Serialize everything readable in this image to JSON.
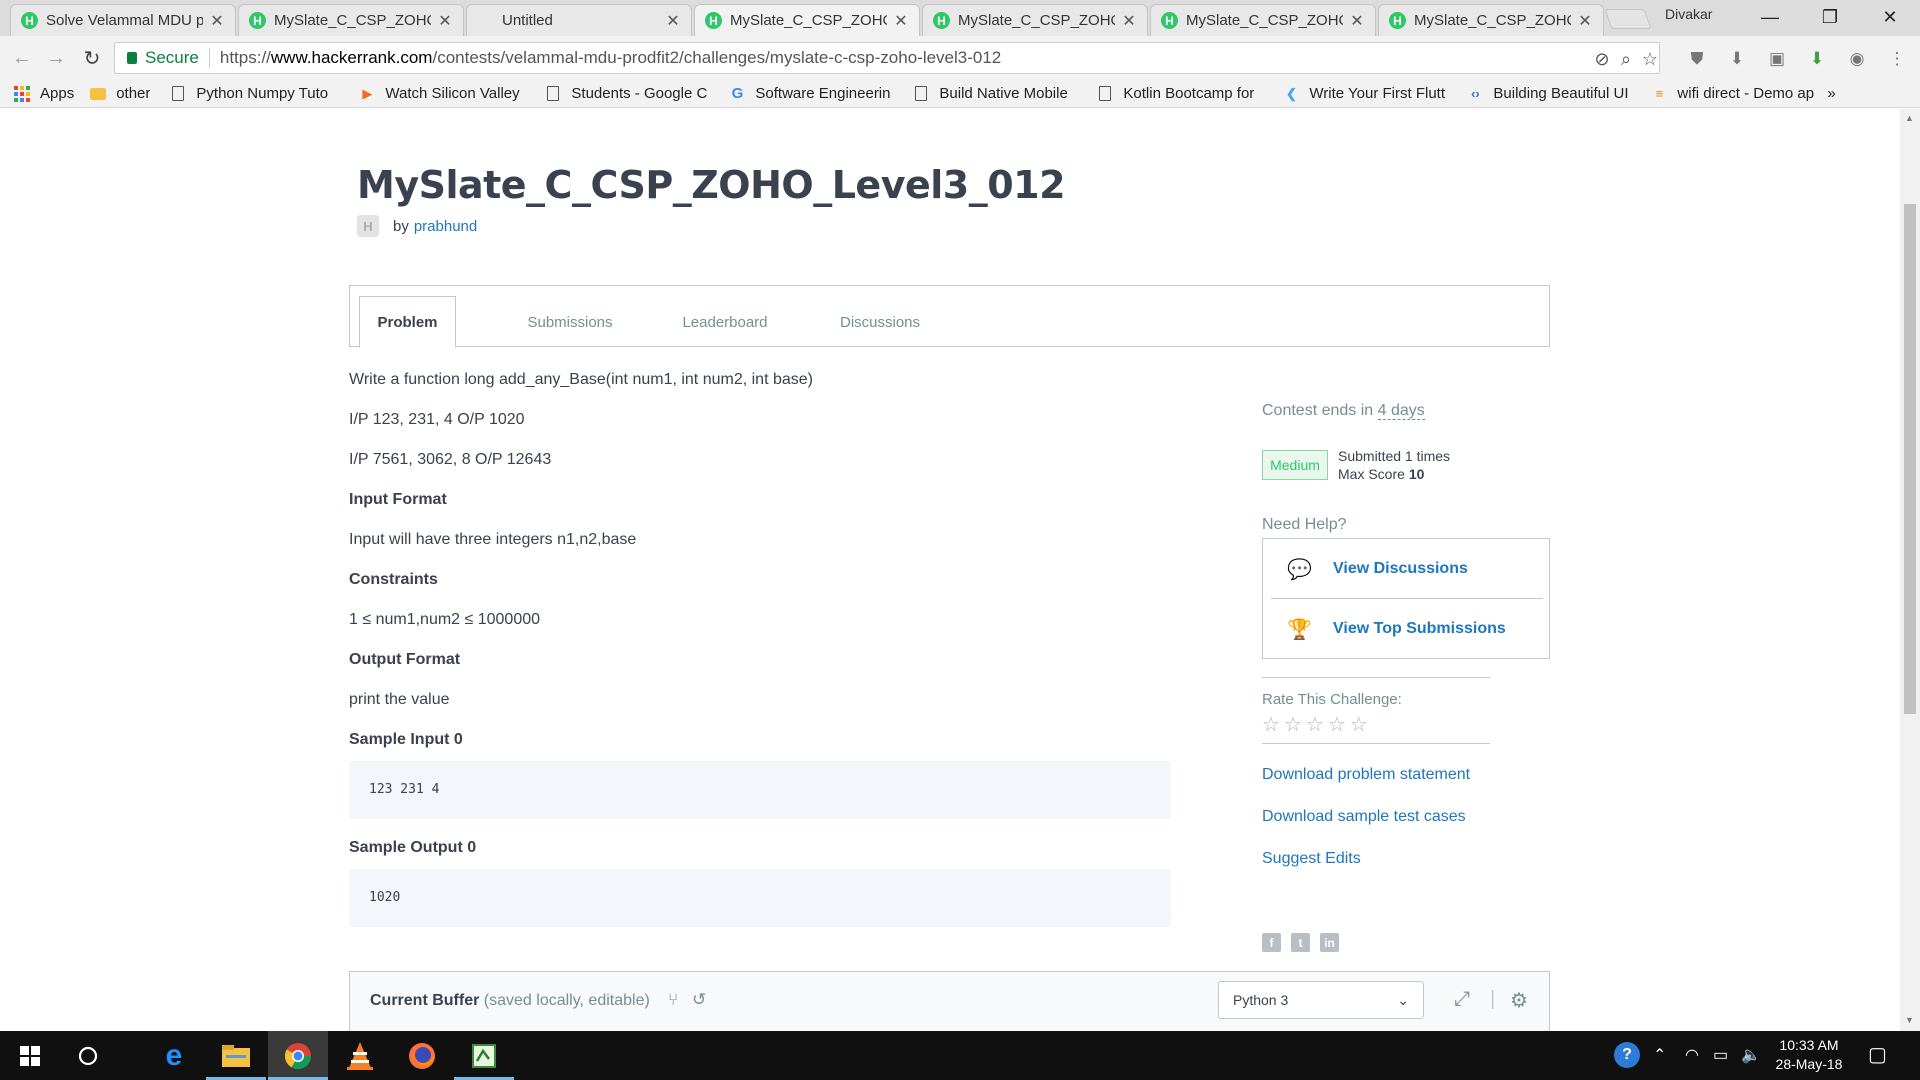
{
  "browser": {
    "tabs": [
      {
        "title": "Solve Velammal MDU p",
        "favicon": "hackerrank",
        "active": false
      },
      {
        "title": "MySlate_C_CSP_ZOHO_",
        "favicon": "hackerrank",
        "active": false
      },
      {
        "title": "Untitled",
        "favicon": "none",
        "active": false
      },
      {
        "title": "MySlate_C_CSP_ZOHO_",
        "favicon": "hackerrank",
        "active": true
      },
      {
        "title": "MySlate_C_CSP_ZOHO_",
        "favicon": "hackerrank",
        "active": false
      },
      {
        "title": "MySlate_C_CSP_ZOHO_",
        "favicon": "hackerrank",
        "active": false
      },
      {
        "title": "MySlate_C_CSP_ZOHO_",
        "favicon": "hackerrank",
        "active": false
      }
    ],
    "profile_name": "Divakar",
    "secure_label": "Secure",
    "url_scheme": "https://",
    "url_host": "www.hackerrank.com",
    "url_path": "/contests/velammal-mdu-prodfit2/challenges/myslate-c-csp-zoho-level3-012",
    "bookmarks": [
      {
        "label": "Apps",
        "icon": "apps-grid-icon"
      },
      {
        "label": "other",
        "icon": "folder-icon"
      },
      {
        "label": "Python Numpy Tuto",
        "icon": "page-icon"
      },
      {
        "label": "Watch Silicon Valley",
        "icon": "play-icon"
      },
      {
        "label": "Students - Google C",
        "icon": "page-icon"
      },
      {
        "label": "Software Engineerin",
        "icon": "google-icon"
      },
      {
        "label": "Build Native Mobile",
        "icon": "page-icon"
      },
      {
        "label": "Kotlin Bootcamp for",
        "icon": "page-icon"
      },
      {
        "label": "Write Your First Flutt",
        "icon": "flutter-icon"
      },
      {
        "label": "Building Beautiful UI",
        "icon": "code-icon"
      },
      {
        "label": "wifi direct - Demo ap",
        "icon": "stackoverflow-icon"
      }
    ],
    "more_bookmarks": "»"
  },
  "challenge": {
    "title": "MySlate_C_CSP_ZOHO_Level3_012",
    "avatar_letter": "H",
    "by_label": "by",
    "author": "prabhund",
    "tabs": [
      "Problem",
      "Submissions",
      "Leaderboard",
      "Discussions"
    ],
    "active_tab": "Problem",
    "statement": "Write a function long add_any_Base(int num1, int num2, int base)",
    "example1": "I/P 123, 231, 4 O/P 1020",
    "example2": "I/P 7561, 3062, 8 O/P 12643",
    "input_format_heading": "Input Format",
    "input_format": "Input will have three integers n1,n2,base",
    "constraints_heading": "Constraints",
    "constraints": "1 ≤ num1,num2 ≤ 1000000",
    "output_format_heading": "Output Format",
    "output_format": "print the value",
    "sample_input_heading": "Sample Input 0",
    "sample_input": "123 231 4",
    "sample_output_heading": "Sample Output 0",
    "sample_output": "1020"
  },
  "sidebar": {
    "contest_ends_prefix": "Contest ends in",
    "contest_ends_value": "4 days",
    "difficulty": "Medium",
    "submitted": "Submitted 1 times",
    "max_score_label": "Max Score",
    "max_score_value": "10",
    "need_help": "Need Help?",
    "view_discussions": "View Discussions",
    "view_top_submissions": "View Top Submissions",
    "rate_label": "Rate This Challenge:",
    "rating": 0,
    "max_rating": 5,
    "download_statement": "Download problem statement",
    "download_tests": "Download sample test cases",
    "suggest_edits": "Suggest Edits",
    "social": [
      "facebook-icon",
      "twitter-icon",
      "linkedin-icon"
    ]
  },
  "editor": {
    "buffer_title": "Current Buffer",
    "buffer_sub": "(saved locally, editable)",
    "language": "Python 3"
  },
  "taskbar": {
    "time": "10:33 AM",
    "date": "28-May-18",
    "apps": [
      "start-icon",
      "cortana-icon",
      "edge-icon",
      "file-explorer-icon",
      "chrome-icon",
      "vlc-icon",
      "firefox-icon",
      "notepad-icon"
    ],
    "active_app": "chrome-icon"
  },
  "colors": {
    "accent_green": "#2ec866",
    "link_blue": "#1f76bb",
    "text_dark": "#39424e",
    "text_muted": "#738f93"
  }
}
